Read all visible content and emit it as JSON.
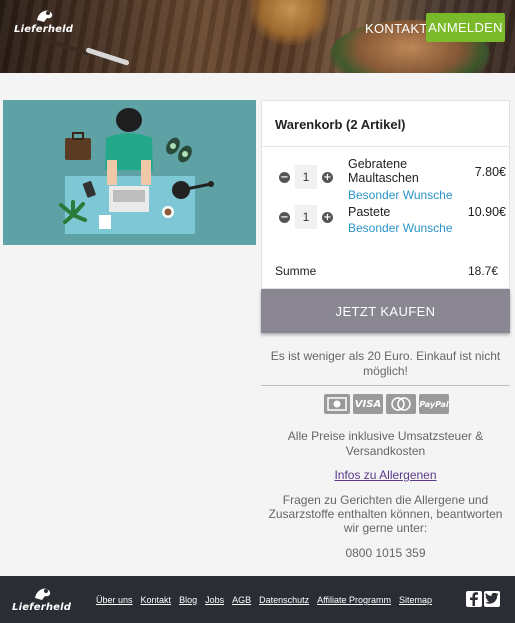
{
  "header": {
    "logo_text": "Lieferheld",
    "nav_kontakt": "KONTAKT",
    "login_label": "ANMELDEN",
    "accent_color": "#7ab929"
  },
  "cart": {
    "title": "Warenkorb (2 Artikel)",
    "items": [
      {
        "quantity": "1",
        "name_line1": "Gebratene",
        "name_line2": "Maultaschen",
        "price": "7.80€",
        "wish_label": "Besonder Wunsche"
      },
      {
        "quantity": "1",
        "name_line1": "Pastete",
        "name_line2": "",
        "price": "10.90€",
        "wish_label": "Besonder Wunsche"
      }
    ],
    "sum_label": "Summe",
    "sum_value": "18.7€",
    "buy_label": "JETZT KAUFEN",
    "minus_symbol": "−",
    "plus_symbol": "+"
  },
  "notes": {
    "min_order_warning": "Es ist weniger als 20 Euro. Einkauf ist nicht möglich!",
    "payment_icons": [
      "cash-icon",
      "visa-icon",
      "mastercard-icon",
      "paypal-icon"
    ],
    "payment_visa": "VISA",
    "payment_paypal": "PayPal",
    "prices_note": "Alle Preise inklusive Umsatzsteuer & Versandkosten",
    "allergen_link": "Infos zu Allergenen",
    "allergen_info": "Fragen zu Gerichten die Allergene und Zusarzstoffe enthalten können, beantworten wir gerne unter:",
    "phone": "0800 1015 359"
  },
  "footer": {
    "logo_text": "Lieferheld",
    "links": [
      "Über uns",
      "Kontakt",
      "Blog",
      "Jobs",
      "AGB",
      "Datenschutz",
      "Affiliate Programm",
      "Sitemap"
    ],
    "social_icons": [
      "facebook-icon",
      "twitter-icon"
    ]
  }
}
